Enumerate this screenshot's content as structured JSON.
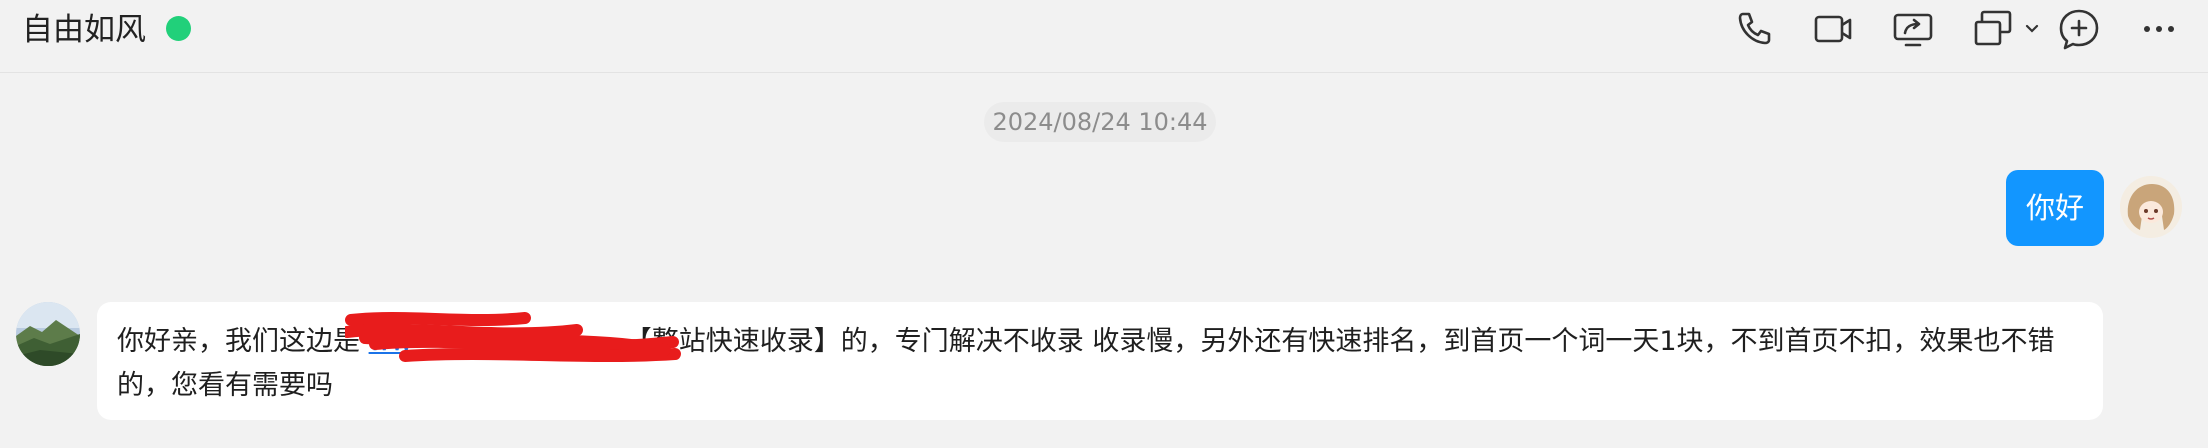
{
  "header": {
    "contact_name": "自由如风",
    "status_color": "#21d07a",
    "icons": [
      "phone-icon",
      "video-camera-icon",
      "screen-share-icon",
      "multi-window-icon",
      "chevron-down-icon",
      "add-chat-icon",
      "more-icon"
    ]
  },
  "timestamp": "2024/08/24 10:44",
  "messages": {
    "outgoing": {
      "text": "你好",
      "bubble_color": "#1296ff"
    },
    "incoming": {
      "text_before_link": "你好亲，我们这边是 ",
      "link_text": "ww",
      "text_after_link": "【整站快速收录】的，专门解决不收录 收录慢，另外还有快速排名，到首页一个词一天1块，不到首页不扣，效果也不错的，您看有需要吗",
      "redaction_color": "#e81c1c"
    }
  },
  "colors": {
    "accent": "#1296ff",
    "background": "#f2f2f2"
  }
}
